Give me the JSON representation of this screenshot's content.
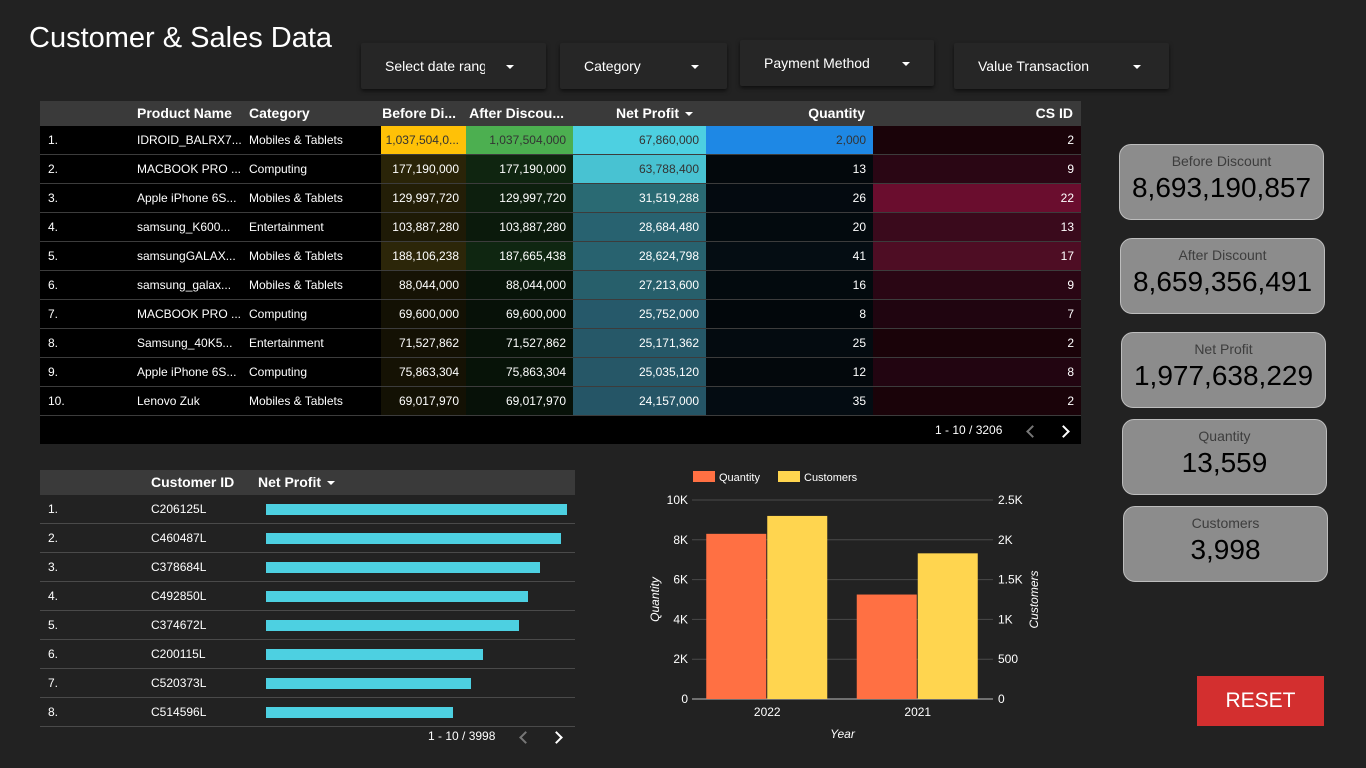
{
  "title": "Customer & Sales Data",
  "filters": [
    {
      "label": "Select date range"
    },
    {
      "label": "Category"
    },
    {
      "label": "Payment Method"
    },
    {
      "label": "Value Transaction"
    }
  ],
  "main_table": {
    "headers": [
      "Product Name",
      "Category",
      "Before Di...",
      "After Discou...",
      "Net Profit",
      "Quantity",
      "CS ID"
    ],
    "rows": [
      {
        "idx": "1.",
        "product": "IDROID_BALRX7...",
        "category": "Mobiles & Tablets",
        "before": "1,037,504,0...",
        "after": "1,037,504,000",
        "profit": "67,860,000",
        "qty": "2,000",
        "csid": "2"
      },
      {
        "idx": "2.",
        "product": "MACBOOK PRO ...",
        "category": "Computing",
        "before": "177,190,000",
        "after": "177,190,000",
        "profit": "63,788,400",
        "qty": "13",
        "csid": "9"
      },
      {
        "idx": "3.",
        "product": "Apple iPhone 6S...",
        "category": "Mobiles & Tablets",
        "before": "129,997,720",
        "after": "129,997,720",
        "profit": "31,519,288",
        "qty": "26",
        "csid": "22"
      },
      {
        "idx": "4.",
        "product": "samsung_K600...",
        "category": "Entertainment",
        "before": "103,887,280",
        "after": "103,887,280",
        "profit": "28,684,480",
        "qty": "20",
        "csid": "13"
      },
      {
        "idx": "5.",
        "product": "samsungGALAX...",
        "category": "Mobiles & Tablets",
        "before": "188,106,238",
        "after": "187,665,438",
        "profit": "28,624,798",
        "qty": "41",
        "csid": "17"
      },
      {
        "idx": "6.",
        "product": "samsung_galax...",
        "category": "Mobiles & Tablets",
        "before": "88,044,000",
        "after": "88,044,000",
        "profit": "27,213,600",
        "qty": "16",
        "csid": "9"
      },
      {
        "idx": "7.",
        "product": "MACBOOK PRO ...",
        "category": "Computing",
        "before": "69,600,000",
        "after": "69,600,000",
        "profit": "25,752,000",
        "qty": "8",
        "csid": "7"
      },
      {
        "idx": "8.",
        "product": "Samsung_40K5...",
        "category": "Entertainment",
        "before": "71,527,862",
        "after": "71,527,862",
        "profit": "25,171,362",
        "qty": "25",
        "csid": "2"
      },
      {
        "idx": "9.",
        "product": "Apple iPhone 6S...",
        "category": "Computing",
        "before": "75,863,304",
        "after": "75,863,304",
        "profit": "25,035,120",
        "qty": "12",
        "csid": "8"
      },
      {
        "idx": "10.",
        "product": "Lenovo Zuk",
        "category": "Mobiles & Tablets",
        "before": "69,017,970",
        "after": "69,017,970",
        "profit": "24,157,000",
        "qty": "35",
        "csid": "2"
      }
    ],
    "pagination": "1 - 10 / 3206",
    "heat_colors": {
      "before": [
        "#ffc107",
        "#2a2408",
        "#231e07",
        "#1e1a06",
        "#2c2609",
        "#161305",
        "#131104",
        "#141104",
        "#151204",
        "#131104"
      ],
      "after": [
        "#4caf50",
        "#0f2510",
        "#0d1f0e",
        "#0b1a0c",
        "#0f2611",
        "#081409",
        "#071108",
        "#071208",
        "#071308",
        "#071108"
      ],
      "profit": [
        "#4dd0e1",
        "#48c2d2",
        "#2a6a73",
        "#286270",
        "#28626f",
        "#275f6b",
        "#26596a",
        "#265868",
        "#265767",
        "#255566"
      ],
      "qty": [
        "#1e88e5",
        "#03080c",
        "#040a10",
        "#030a0e",
        "#050d13",
        "#030a0e",
        "#02070b",
        "#040b10",
        "#03080c",
        "#040c12"
      ],
      "csid": [
        "#1a0309",
        "#2a0614",
        "#6a0d2e",
        "#3a0a1c",
        "#4e0d24",
        "#2a0614",
        "#200510",
        "#1a0309",
        "#220511",
        "#1a0309"
      ]
    }
  },
  "scorecards": [
    {
      "label": "Before Discount",
      "value": "8,693,190,857"
    },
    {
      "label": "After Discount",
      "value": "8,659,356,491"
    },
    {
      "label": "Net Profit",
      "value": "1,977,638,229"
    },
    {
      "label": "Quantity",
      "value": "13,559"
    },
    {
      "label": "Customers",
      "value": "3,998"
    }
  ],
  "customer_table": {
    "headers": [
      "Customer ID",
      "Net Profit"
    ],
    "rows": [
      {
        "idx": "1.",
        "id": "C206125L",
        "profit_fraction": 1.0
      },
      {
        "idx": "2.",
        "id": "C460487L",
        "profit_fraction": 0.98
      },
      {
        "idx": "3.",
        "id": "C378684L",
        "profit_fraction": 0.91
      },
      {
        "idx": "4.",
        "id": "C492850L",
        "profit_fraction": 0.87
      },
      {
        "idx": "5.",
        "id": "C374672L",
        "profit_fraction": 0.84
      },
      {
        "idx": "6.",
        "id": "C200115L",
        "profit_fraction": 0.72
      },
      {
        "idx": "7.",
        "id": "C520373L",
        "profit_fraction": 0.68
      },
      {
        "idx": "8.",
        "id": "C514596L",
        "profit_fraction": 0.62
      }
    ],
    "bar_color": "#4dd0e1",
    "pagination": "1 - 10 / 3998"
  },
  "chart_data": {
    "type": "bar",
    "categories": [
      "2022",
      "2021"
    ],
    "series": [
      {
        "name": "Quantity",
        "values": [
          8300,
          5250
        ],
        "axis": "left",
        "color": "#ff7043"
      },
      {
        "name": "Customers",
        "values": [
          2300,
          1830
        ],
        "axis": "right",
        "color": "#ffd54f"
      }
    ],
    "xlabel": "Year",
    "ylabel_left": "Quantity",
    "ylabel_right": "Customers",
    "ylim_left": [
      0,
      10000
    ],
    "ylim_right": [
      0,
      2500
    ],
    "yticks_left": [
      "0",
      "2K",
      "4K",
      "6K",
      "8K",
      "10K"
    ],
    "yticks_right": [
      "0",
      "500",
      "1K",
      "1.5K",
      "2K",
      "2.5K"
    ],
    "legend_position": "top-left",
    "grid": true
  },
  "reset_label": "RESET",
  "icons": {
    "sort": "caret-down-icon",
    "prev": "chevron-left-icon",
    "next": "chevron-right-icon"
  }
}
